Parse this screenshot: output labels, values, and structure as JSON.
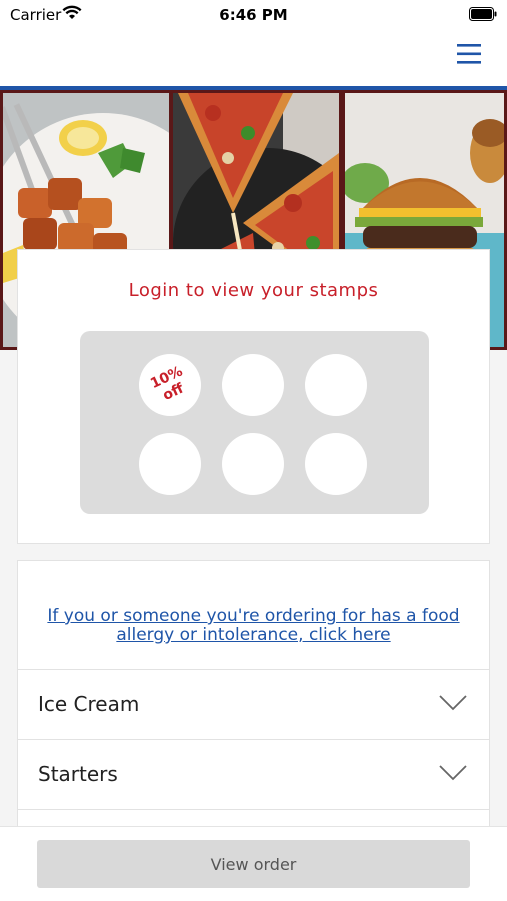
{
  "status_bar": {
    "carrier": "Carrier",
    "time": "6:46 PM"
  },
  "nav": {
    "menu_icon": "hamburger-menu-icon"
  },
  "hero": {
    "images": [
      "grilled-chicken-skewers",
      "pizza-slice",
      "burger"
    ]
  },
  "stamp_card": {
    "login_text": "Login to view your stamps",
    "reward_label": "10% off",
    "stamps_total": 6
  },
  "menu": {
    "allergy_text": "If you or someone you're ordering for has a food allergy or intolerance, click here",
    "categories": [
      {
        "label": "Ice Cream"
      },
      {
        "label": "Starters"
      }
    ]
  },
  "footer": {
    "view_order_label": "View order"
  },
  "colors": {
    "brand_blue": "#1f55a8",
    "accent_red": "#c8202a"
  }
}
